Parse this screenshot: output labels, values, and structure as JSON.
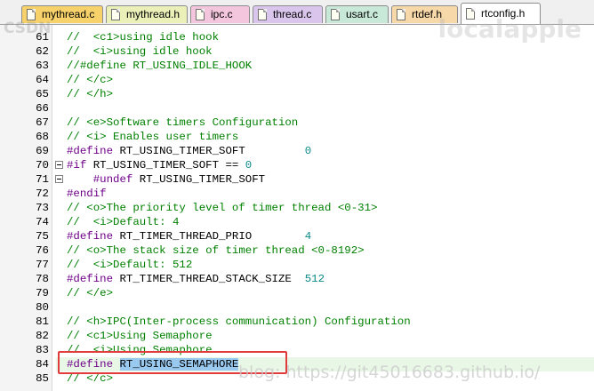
{
  "tabs": [
    {
      "label": "mythread.c",
      "color": "#f7d26a",
      "active": false
    },
    {
      "label": "mythread.h",
      "color": "#eaf0b8",
      "active": false
    },
    {
      "label": "ipc.c",
      "color": "#f4c6dd",
      "active": false
    },
    {
      "label": "thread.c",
      "color": "#dac6ec",
      "active": false
    },
    {
      "label": "usart.c",
      "color": "#c8e8d8",
      "active": false
    },
    {
      "label": "rtdef.h",
      "color": "#f7d8a8",
      "active": false
    },
    {
      "label": "rtconfig.h",
      "color": "#ffffff",
      "active": true
    }
  ],
  "editor": {
    "lines": [
      {
        "num": "61",
        "text": "//  <c1>using idle hook"
      },
      {
        "num": "62",
        "text": "//  <i>using idle hook"
      },
      {
        "num": "63",
        "text": "//#define RT_USING_IDLE_HOOK"
      },
      {
        "num": "64",
        "text": "// </c>"
      },
      {
        "num": "65",
        "text": "// </h>"
      },
      {
        "num": "66",
        "text": ""
      },
      {
        "num": "67",
        "text": "// <e>Software timers Configuration"
      },
      {
        "num": "68",
        "text": "// <i> Enables user timers"
      },
      {
        "num": "69",
        "text": "#define RT_USING_TIMER_SOFT         0"
      },
      {
        "num": "70",
        "text": "#if RT_USING_TIMER_SOFT == 0"
      },
      {
        "num": "71",
        "text": "    #undef RT_USING_TIMER_SOFT"
      },
      {
        "num": "72",
        "text": "#endif"
      },
      {
        "num": "73",
        "text": "// <o>The priority level of timer thread <0-31>"
      },
      {
        "num": "74",
        "text": "//  <i>Default: 4"
      },
      {
        "num": "75",
        "text": "#define RT_TIMER_THREAD_PRIO        4"
      },
      {
        "num": "76",
        "text": "// <o>The stack size of timer thread <0-8192>"
      },
      {
        "num": "77",
        "text": "//  <i>Default: 512"
      },
      {
        "num": "78",
        "text": "#define RT_TIMER_THREAD_STACK_SIZE  512"
      },
      {
        "num": "79",
        "text": "// </e>"
      },
      {
        "num": "80",
        "text": ""
      },
      {
        "num": "81",
        "text": "// <h>IPC(Inter-process communication) Configuration"
      },
      {
        "num": "82",
        "text": "// <c1>Using Semaphore"
      },
      {
        "num": "83",
        "text": "//  <i>Using Semaphore"
      },
      {
        "num": "84",
        "text": "#define RT_USING_SEMAPHORE"
      },
      {
        "num": "85",
        "text": "// </c>"
      }
    ],
    "highlighted_line": "84",
    "selected_text": "RT_USING_SEMAPHORE"
  },
  "watermarks": {
    "top_left": "CSDN",
    "top_right": "localapple",
    "bottom": "blog: https://git45016683.github.io/"
  }
}
